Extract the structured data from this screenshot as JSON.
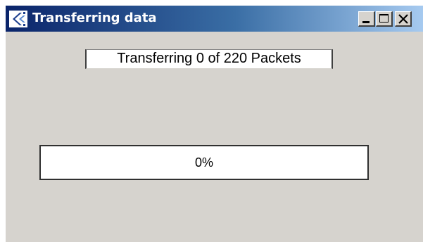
{
  "window": {
    "title": "Transferring data",
    "icon": "app-arrow-icon",
    "controls": {
      "minimize": "minimize-icon",
      "maximize": "maximize-icon",
      "close": "close-icon"
    }
  },
  "status": {
    "text": "Transferring 0 of 220 Packets"
  },
  "progress": {
    "label": "0%",
    "value": 0
  },
  "colors": {
    "titlebar_start": "#0a246a",
    "titlebar_end": "#a6caf0",
    "window_bg": "#d6d3ce"
  }
}
